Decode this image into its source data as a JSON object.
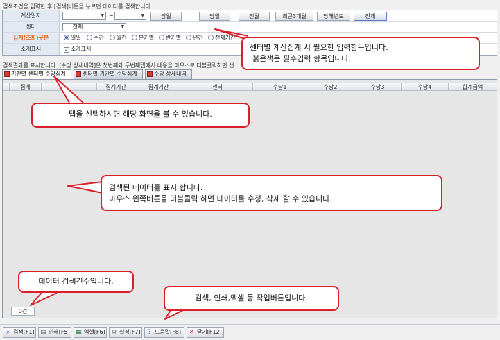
{
  "top_hint": "검색조건을 입력한 후 [검색]버튼을 누르면 데이터를 검색합니다.",
  "form": {
    "date_label": "계산일자",
    "date_from": "",
    "date_to": "",
    "tilde": "~",
    "range_buttons": [
      "당일",
      "당월",
      "전월",
      "최근3개월",
      "당해년도",
      "전체"
    ],
    "center_label": "센터",
    "center_value": "::: 전체 :::",
    "group_label": "집계(조회)구분",
    "group_options": [
      "일일",
      "주간",
      "월간",
      "분기별",
      "반기별",
      "년간",
      "전체기간"
    ],
    "sum_label": "소계표시",
    "sum_check": "소계표시"
  },
  "result_hint": "검색결과를 표시합니다. [수당 상세내역]은 첫번째와 두번째탭에서 내용을 마우스로 더블클릭하면 선",
  "tabs": [
    "기간별 센터별 수당집계",
    "센터별 기간별 수당집계",
    "수당 상세내역"
  ],
  "grid": {
    "columns": [
      "집계",
      "",
      "집계기간",
      "집계기간",
      "센터",
      "수당1",
      "수당2",
      "수당3",
      "수당4",
      "합계금액"
    ],
    "count": "0건"
  },
  "toolbar": [
    {
      "label": "검색[F1]",
      "icon": "search-icon"
    },
    {
      "label": "인쇄[F5]",
      "icon": "printer-icon"
    },
    {
      "label": "엑셀[F6]",
      "icon": "excel-icon"
    },
    {
      "label": "설정[F7]",
      "icon": "gear-icon"
    },
    {
      "label": "도움말[F8]",
      "icon": "help-icon"
    },
    {
      "label": "닫기[F12]",
      "icon": "close-icon"
    }
  ],
  "callouts": {
    "form_line1": "센터별 계산집계 시 필요한 입력항목입니다.",
    "form_line2": "붉은색은 필수입력 항목입니다.",
    "tabs": "탭을 선택하시면 해당 화면을 볼 수 있습니다.",
    "grid_line1": "검색된 데이터를 표시 합니다.",
    "grid_line2": "마우스 왼쪽버튼을 더블클릭 하면 데이터를 수정, 삭제 할 수 있습니다.",
    "count": "데이터 검색건수입니다.",
    "toolbar": "검색, 인쇄,엑셀 등 작업버튼입니다."
  },
  "colors": {
    "required_label": "#e2631d",
    "callout_border": "#d9202b"
  }
}
